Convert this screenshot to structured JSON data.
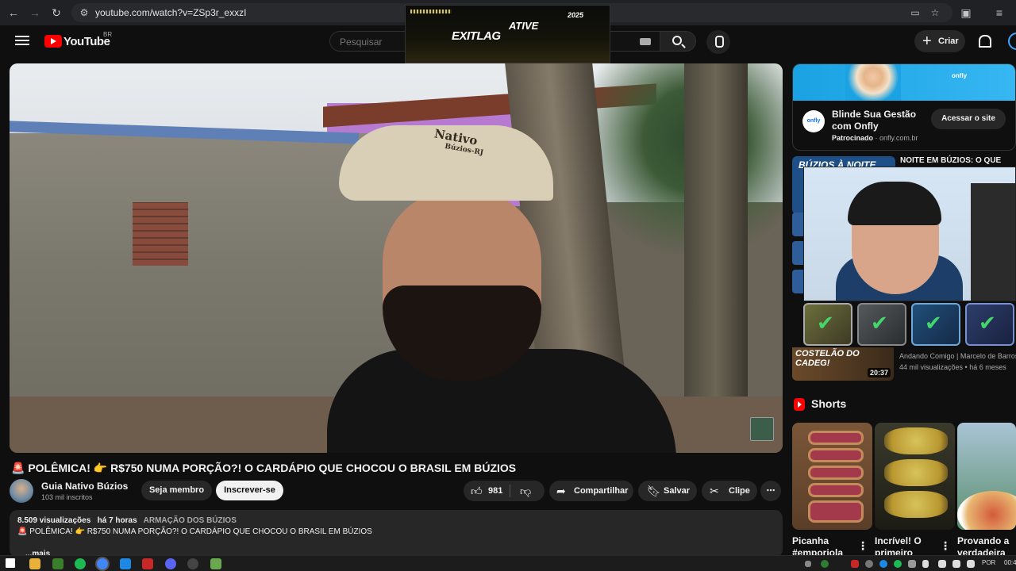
{
  "browser": {
    "url": "youtube.com/watch?v=ZSp3r_exxzI"
  },
  "header": {
    "logo_text": "YouTube",
    "country_code": "BR",
    "search_placeholder": "Pesquisar",
    "create_label": "Criar"
  },
  "overlay": {
    "brand": "EXITLAG",
    "cta": "ATIVE",
    "tag": "2025"
  },
  "video": {
    "cap_text": "Nativo",
    "cap_subtext": "Búzios-RJ",
    "title": "🚨 POLÊMICA! 👉 R$750 NUMA PORÇÃO?! O CARDÁPIO QUE CHOCOU O BRASIL EM BÚZIOS"
  },
  "channel": {
    "name": "Guia Nativo Búzios",
    "subscribers": "103 mil inscritos",
    "member_label": "Seja membro",
    "subscribe_label": "Inscrever-se"
  },
  "actions": {
    "like_count": "981",
    "share_label": "Compartilhar",
    "save_label": "Salvar",
    "clip_label": "Clipe",
    "more_label": "⋯"
  },
  "description": {
    "views": "8.509 visualizações",
    "age": "há 7 horas",
    "tags": "ARMAÇÃO DOS BÚZIOS",
    "line": "🚨 POLÊMICA! 👉 R$750 NUMA PORÇÃO?! O CARDÁPIO QUE CHOCOU O BRASIL EM BÚZIOS",
    "more": "...mais"
  },
  "ad": {
    "banner_logo": "onfly",
    "logo_text": "onfly",
    "title": "Blinde Sua Gestão com Onfly",
    "sponsored": "Patrocinado",
    "domain": "onfly.com.br",
    "cta": "Acessar o site"
  },
  "recommendations": [
    {
      "thumb_text": "BÚZIOS À NOITE",
      "title": "NOITE EM BÚZIOS: O QUE"
    },
    {
      "thumb_text": "COSTELÃO DO CADEG!",
      "duration": "20:37",
      "channel": "Andando Comigo | Marcelo de Barros",
      "views": "44 mil visualizações",
      "age": "há 6 meses"
    }
  ],
  "shorts": {
    "heading": "Shorts",
    "items": [
      {
        "title": "Picanha #emporiola"
      },
      {
        "title": "Incrível! O primeiro"
      },
      {
        "title": "Provando a verdadeira"
      }
    ]
  },
  "taskbar": {
    "lang": "POR",
    "time": "00:4"
  },
  "colors": {
    "background": "#0f0f0f",
    "accent_red": "#ff0000",
    "surface": "#272727",
    "text": "#f1f1f1",
    "muted": "#aaaaaa"
  }
}
